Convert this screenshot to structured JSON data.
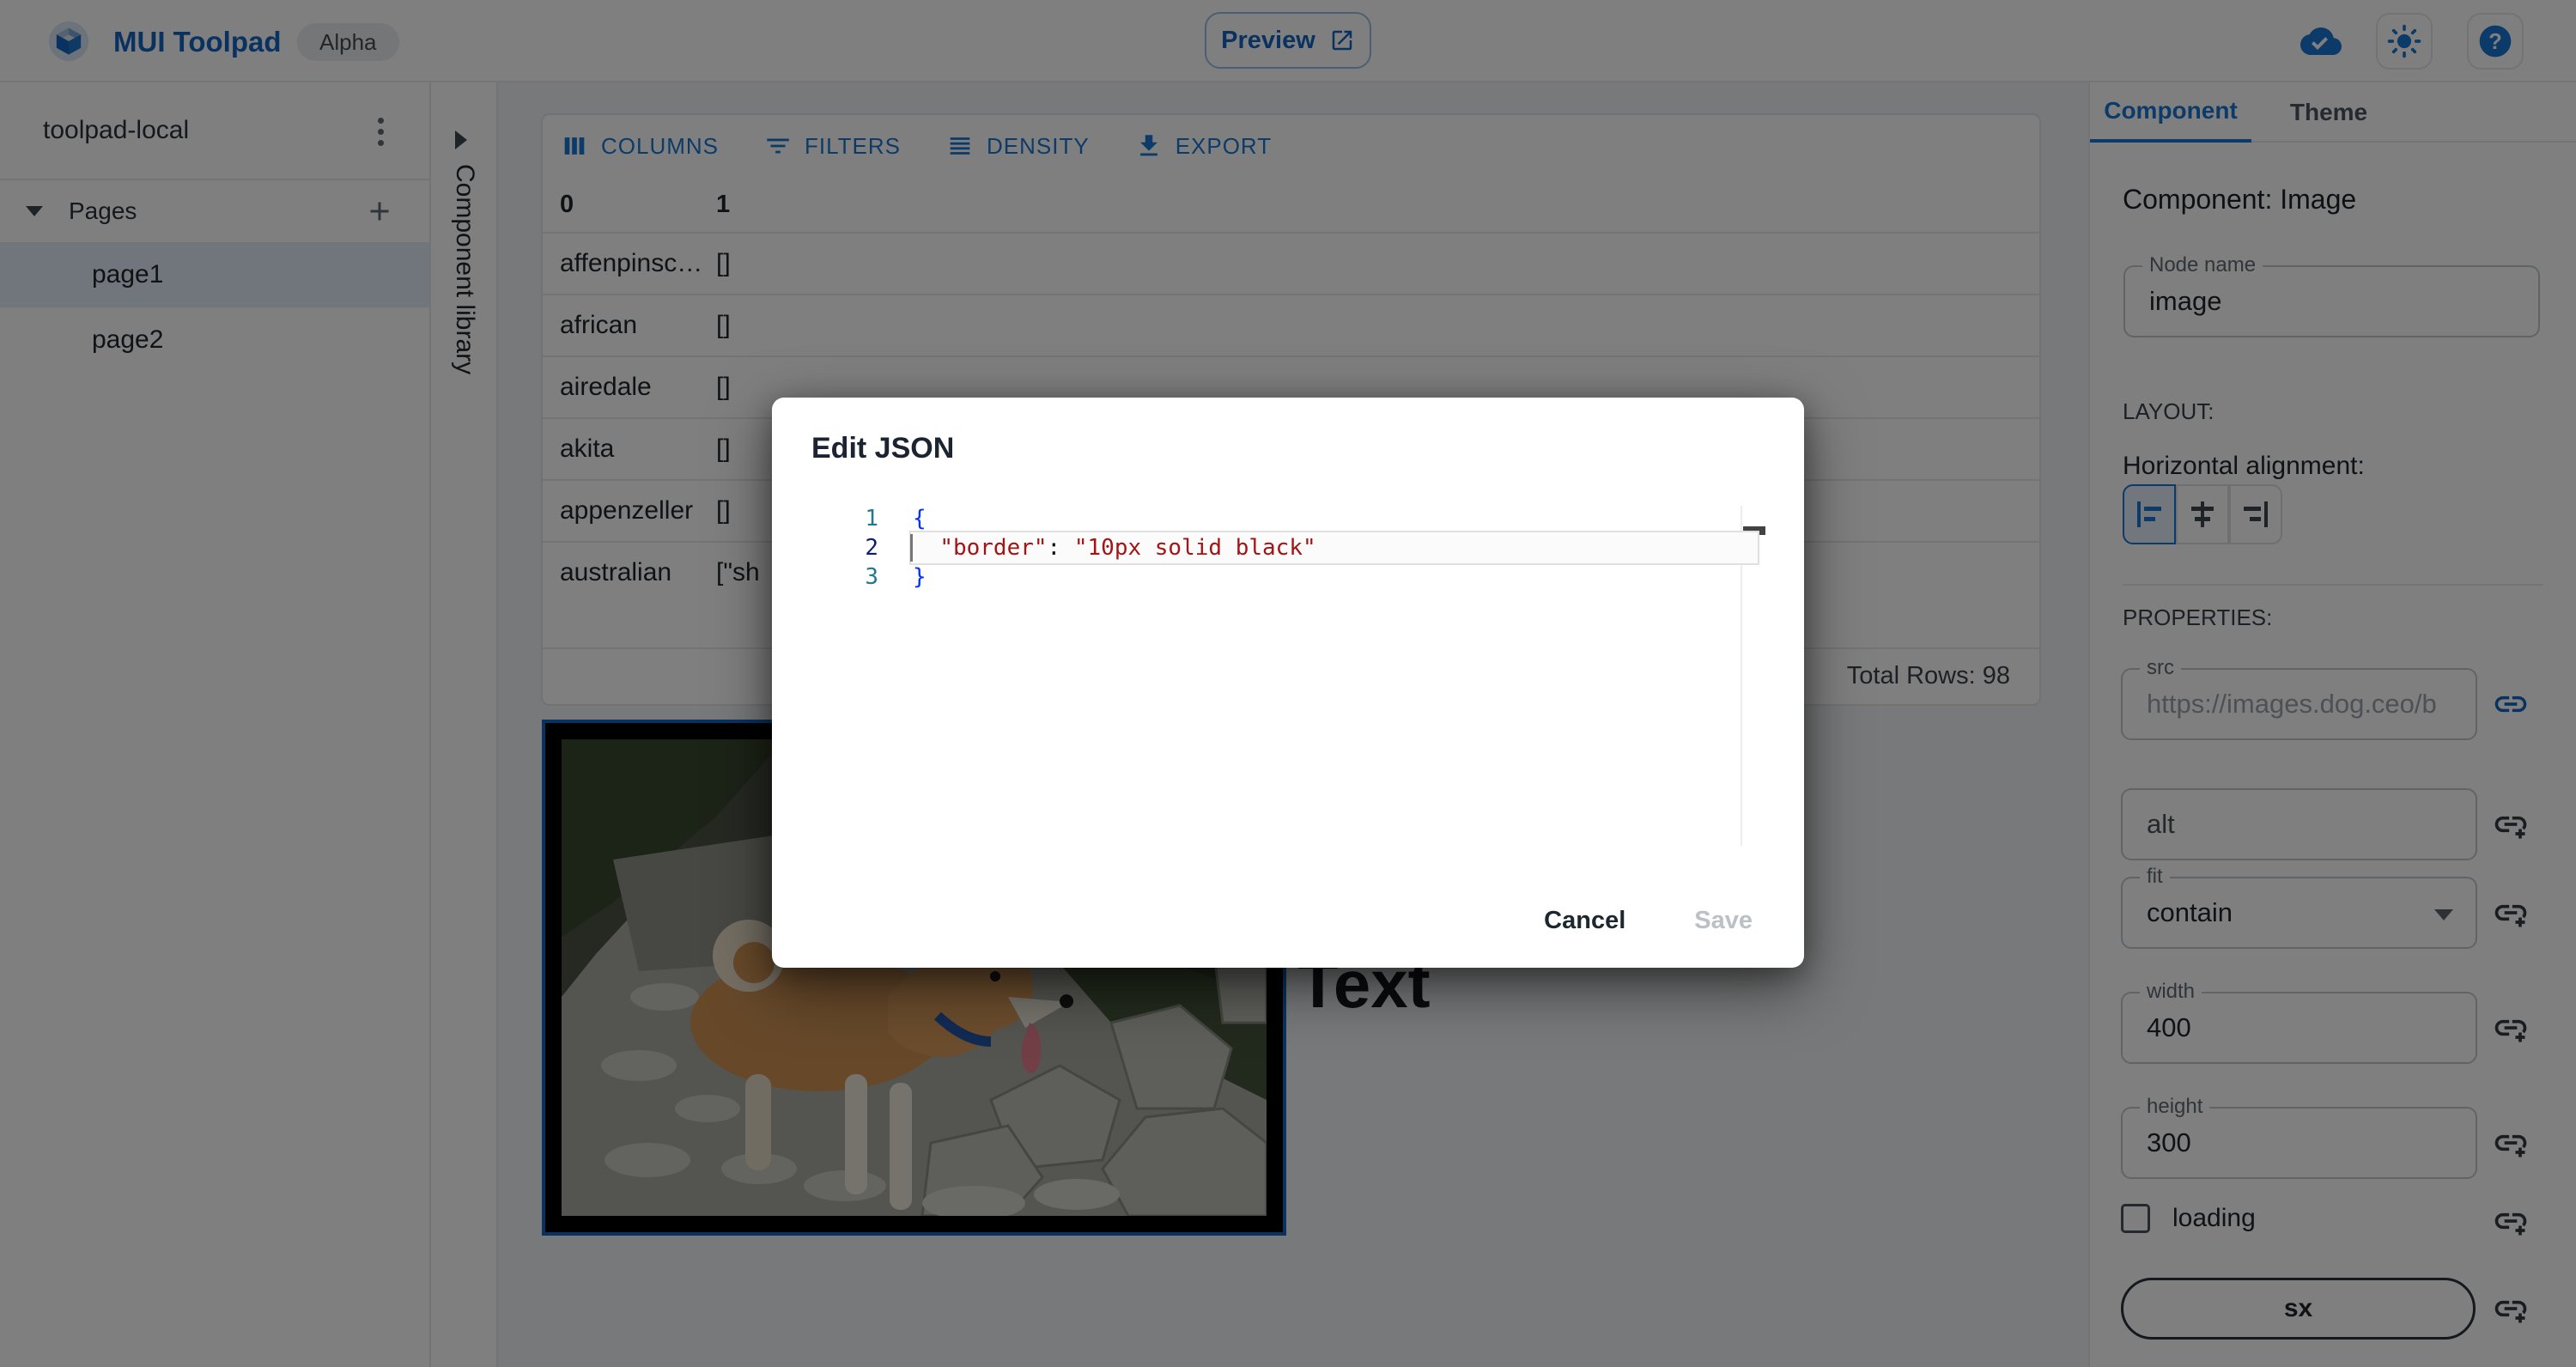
{
  "header": {
    "app_title": "MUI Toolpad",
    "alpha_badge": "Alpha",
    "preview_button": "Preview"
  },
  "explorer": {
    "project_name": "toolpad-local",
    "pages_label": "Pages",
    "pages": [
      {
        "name": "page1",
        "selected": true
      },
      {
        "name": "page2",
        "selected": false
      }
    ]
  },
  "component_library": {
    "label": "Component library"
  },
  "canvas": {
    "grid": {
      "toolbar": {
        "columns": "COLUMNS",
        "filters": "FILTERS",
        "density": "DENSITY",
        "export": "EXPORT"
      },
      "column_headers": [
        "0",
        "1"
      ],
      "rows": [
        {
          "name": "affenpinsc…",
          "value": "[]"
        },
        {
          "name": "african",
          "value": "[]"
        },
        {
          "name": "airedale",
          "value": "[]"
        },
        {
          "name": "akita",
          "value": "[]"
        },
        {
          "name": "appenzeller",
          "value": "[]"
        },
        {
          "name": "australian",
          "value": "[\"sh"
        }
      ],
      "footer": "Total Rows: 98"
    },
    "text_component": "Text"
  },
  "dialog": {
    "title": "Edit JSON",
    "code": {
      "line_numbers": [
        "1",
        "2",
        "3"
      ],
      "line1": "{",
      "line2_indent": "  ",
      "line2_key": "\"border\"",
      "line2_sep": ": ",
      "line2_value": "\"10px solid black\"",
      "line3": "}"
    },
    "cancel_button": "Cancel",
    "save_button": "Save"
  },
  "inspector": {
    "tabs": {
      "component": "Component",
      "theme": "Theme"
    },
    "heading": "Component: Image",
    "node_name": {
      "label": "Node name",
      "value": "image"
    },
    "layout_label": "LAYOUT:",
    "alignment_label": "Horizontal alignment:",
    "properties_label": "PROPERTIES:",
    "src": {
      "label": "src",
      "value": "https://images.dog.ceo/b"
    },
    "alt": {
      "label": "alt"
    },
    "fit": {
      "label": "fit",
      "value": "contain"
    },
    "width": {
      "label": "width",
      "value": "400"
    },
    "height": {
      "label": "height",
      "value": "300"
    },
    "loading_label": "loading",
    "sx_button": "sx"
  },
  "colors": {
    "primary": "#1976d2",
    "title_blue": "#1565c0",
    "selection_blue": "#1565c0",
    "string_red": "#a31515",
    "brace_blue": "#0431fa",
    "line_number": "#237893",
    "active_line_number": "#0b216f"
  }
}
